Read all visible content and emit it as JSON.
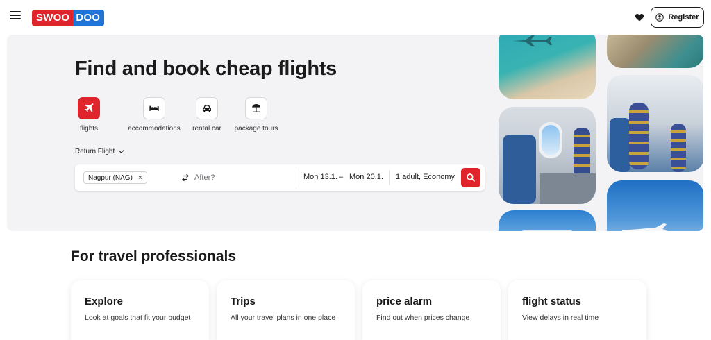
{
  "header": {
    "logo_part1": "SWOO",
    "logo_part2": "DOO",
    "register_label": "Register",
    "colors": {
      "brand_red": "#e0242b",
      "brand_blue": "#1f74d8"
    }
  },
  "hero": {
    "title": "Find and book cheap flights",
    "verticals": [
      {
        "label": "flights",
        "icon": "airplane-icon",
        "active": true
      },
      {
        "label": "accommodations",
        "icon": "bed-icon",
        "active": false
      },
      {
        "label": "rental car",
        "icon": "car-icon",
        "active": false
      },
      {
        "label": "package tours",
        "icon": "beach-umbrella-icon",
        "active": false
      }
    ],
    "trip_type": "Return Flight"
  },
  "search": {
    "origin_chip": "Nagpur (NAG)",
    "chip_remove": "×",
    "destination_placeholder": "After?",
    "depart_date": "Mon 13.1.",
    "date_separator": "–",
    "return_date": "Mon 20.1.",
    "travelers": "1 adult, Economy"
  },
  "pros": {
    "title": "For travel professionals",
    "cards": [
      {
        "title": "Explore",
        "desc": "Look at goals that fit your budget"
      },
      {
        "title": "Trips",
        "desc": "All your travel plans in one place"
      },
      {
        "title": "price alarm",
        "desc": "Find out when prices change"
      },
      {
        "title": "flight status",
        "desc": "View delays in real time"
      }
    ]
  }
}
